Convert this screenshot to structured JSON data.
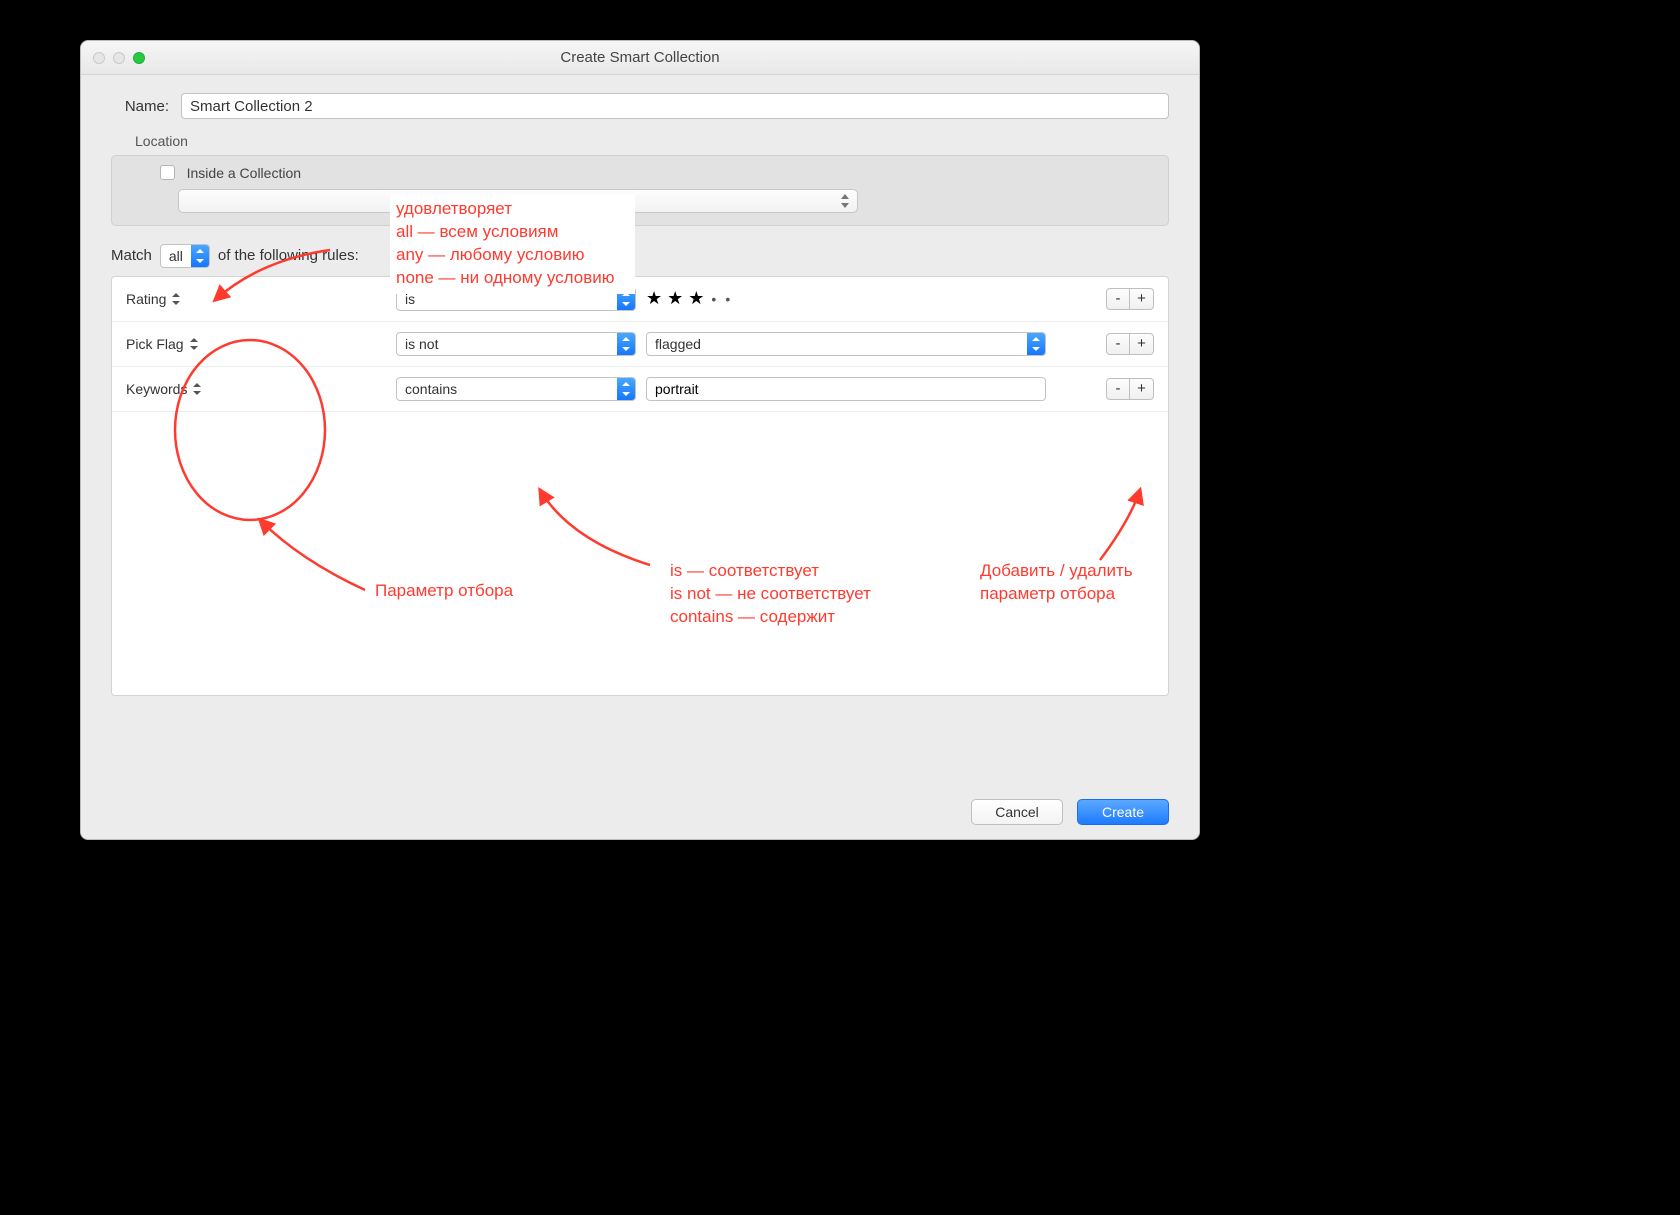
{
  "window": {
    "title": "Create Smart Collection"
  },
  "name": {
    "label": "Name:",
    "value": "Smart Collection 2"
  },
  "location": {
    "section_label": "Location",
    "inside_checkbox_label": "Inside a Collection"
  },
  "match": {
    "prefix": "Match",
    "mode": "all",
    "suffix": "of the following rules:"
  },
  "rules": [
    {
      "criteria": "Rating",
      "op": "is",
      "value_type": "stars",
      "stars_filled": 3,
      "stars_total": 5
    },
    {
      "criteria": "Pick Flag",
      "op": "is not",
      "value_type": "select",
      "value": "flagged"
    },
    {
      "criteria": "Keywords",
      "op": "contains",
      "value_type": "text",
      "value": "portrait"
    }
  ],
  "buttons": {
    "remove": "-",
    "add": "+",
    "cancel": "Cancel",
    "create": "Create"
  },
  "annotations": {
    "match_explain": {
      "line1": "удовлетворяет",
      "line2": "all — всем условиям",
      "line3": "any — любому условию",
      "line4": "none — ни одному условию"
    },
    "criteria_label": "Параметр отбора",
    "op_explain": {
      "line1": "is — соответствует",
      "line2": "is not — не соответствует",
      "line3": "contains — содержит"
    },
    "addremove_label": "Добавить / удалить параметр отбора"
  }
}
